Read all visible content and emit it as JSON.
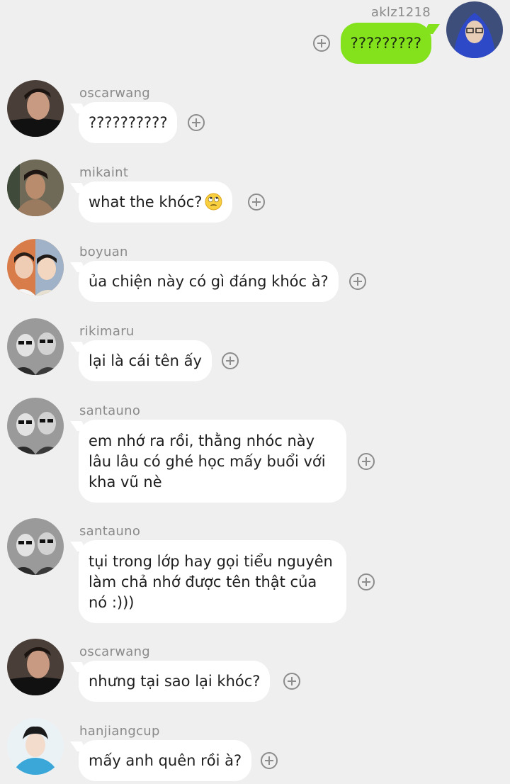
{
  "messages": [
    {
      "user": "aklz1218",
      "text": "?????????",
      "mine": true
    },
    {
      "user": "oscarwang",
      "text": "??????????"
    },
    {
      "user": "mikaint",
      "text": "what the khóc?",
      "emoji": "rolling-eyes-face"
    },
    {
      "user": "boyuan",
      "text": "ủa chiện này có gì đáng khóc à?"
    },
    {
      "user": "rikimaru",
      "text": "lại là cái tên ấy"
    },
    {
      "user": "santauno",
      "text": "em nhớ ra rồi, thằng nhóc này lâu lâu có ghé học mấy buổi với kha vũ nè"
    },
    {
      "user": "santauno",
      "text": "tụi trong lớp hay gọi tiểu nguyên làm chả nhớ được tên thật của nó :)))"
    },
    {
      "user": "oscarwang",
      "text": "nhưng tại sao lại khóc?"
    },
    {
      "user": "hanjiangcup",
      "text": "mấy anh quên rồi à?"
    }
  ],
  "colors": {
    "background": "#efefef",
    "incoming_bubble": "#ffffff",
    "outgoing_bubble": "#84e21d",
    "username": "#8a8a8a"
  }
}
